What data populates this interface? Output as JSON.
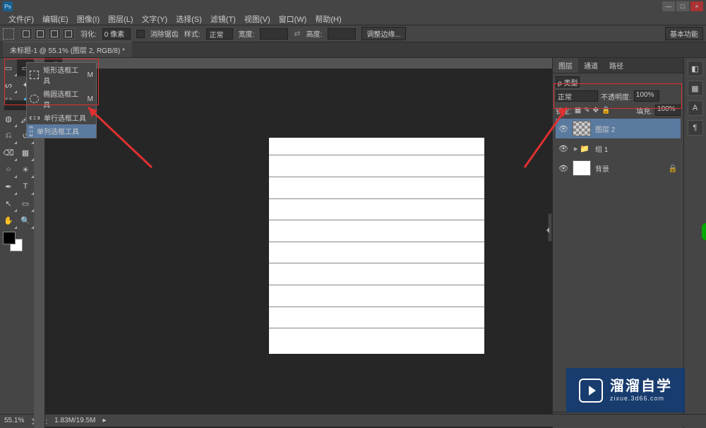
{
  "app_logo": "Ps",
  "menus": [
    "文件(F)",
    "编辑(E)",
    "图像(I)",
    "图层(L)",
    "文字(Y)",
    "选择(S)",
    "滤镜(T)",
    "视图(V)",
    "窗口(W)",
    "帮助(H)"
  ],
  "window_controls": {
    "min": "—",
    "max": "□",
    "close": "×"
  },
  "options_bar": {
    "feather_label": "羽化:",
    "feather_value": "0 像素",
    "antialias": "消除锯齿",
    "style_label": "样式:",
    "style_value": "正常",
    "width_label": "宽度:",
    "width_value": "",
    "height_label": "高度:",
    "height_value": "",
    "refine_edge": "调整边缘...",
    "workspace": "基本功能"
  },
  "doc_tab": "未标题-1 @ 55.1% (图层 2, RGB/8) *",
  "marquee_menu": {
    "items": [
      {
        "label": "矩形选框工具",
        "shortcut": "M"
      },
      {
        "label": "椭圆选框工具",
        "shortcut": "M"
      },
      {
        "label": "单行选框工具",
        "shortcut": ""
      },
      {
        "label": "单列选框工具",
        "shortcut": ""
      }
    ],
    "selected_index": 3
  },
  "layers_panel": {
    "tabs": [
      "图层",
      "通道",
      "路径"
    ],
    "kind_label": "ρ 类型",
    "blend_mode": "正常",
    "opacity_label": "不透明度:",
    "opacity_value": "100%",
    "lock_label": "锁定:",
    "fill_label": "填充:",
    "fill_value": "100%",
    "layers": [
      {
        "name": "图层 2",
        "type": "transparent",
        "selected": true
      },
      {
        "name": "组 1",
        "type": "folder",
        "collapsed": true
      },
      {
        "name": "背景",
        "type": "white",
        "locked": true
      }
    ]
  },
  "status": {
    "zoom": "55.1%",
    "doc_label": "文档:",
    "doc_size": "1.83M/19.5M"
  },
  "watermark": {
    "main": "溜溜自学",
    "sub": "zixue.3d66.com"
  },
  "tool_names": [
    [
      "move",
      "marquee"
    ],
    [
      "lasso",
      "quick-select"
    ],
    [
      "crop",
      "eyedropper"
    ],
    [
      "spot-heal",
      "brush"
    ],
    [
      "clone",
      "history-brush"
    ],
    [
      "eraser",
      "gradient"
    ],
    [
      "blur",
      "dodge"
    ],
    [
      "pen",
      "type"
    ],
    [
      "path-select",
      "rectangle"
    ],
    [
      "hand",
      "zoom"
    ]
  ],
  "canvas_line_percents": [
    8,
    18,
    28,
    38,
    48,
    58,
    68,
    78,
    88
  ]
}
